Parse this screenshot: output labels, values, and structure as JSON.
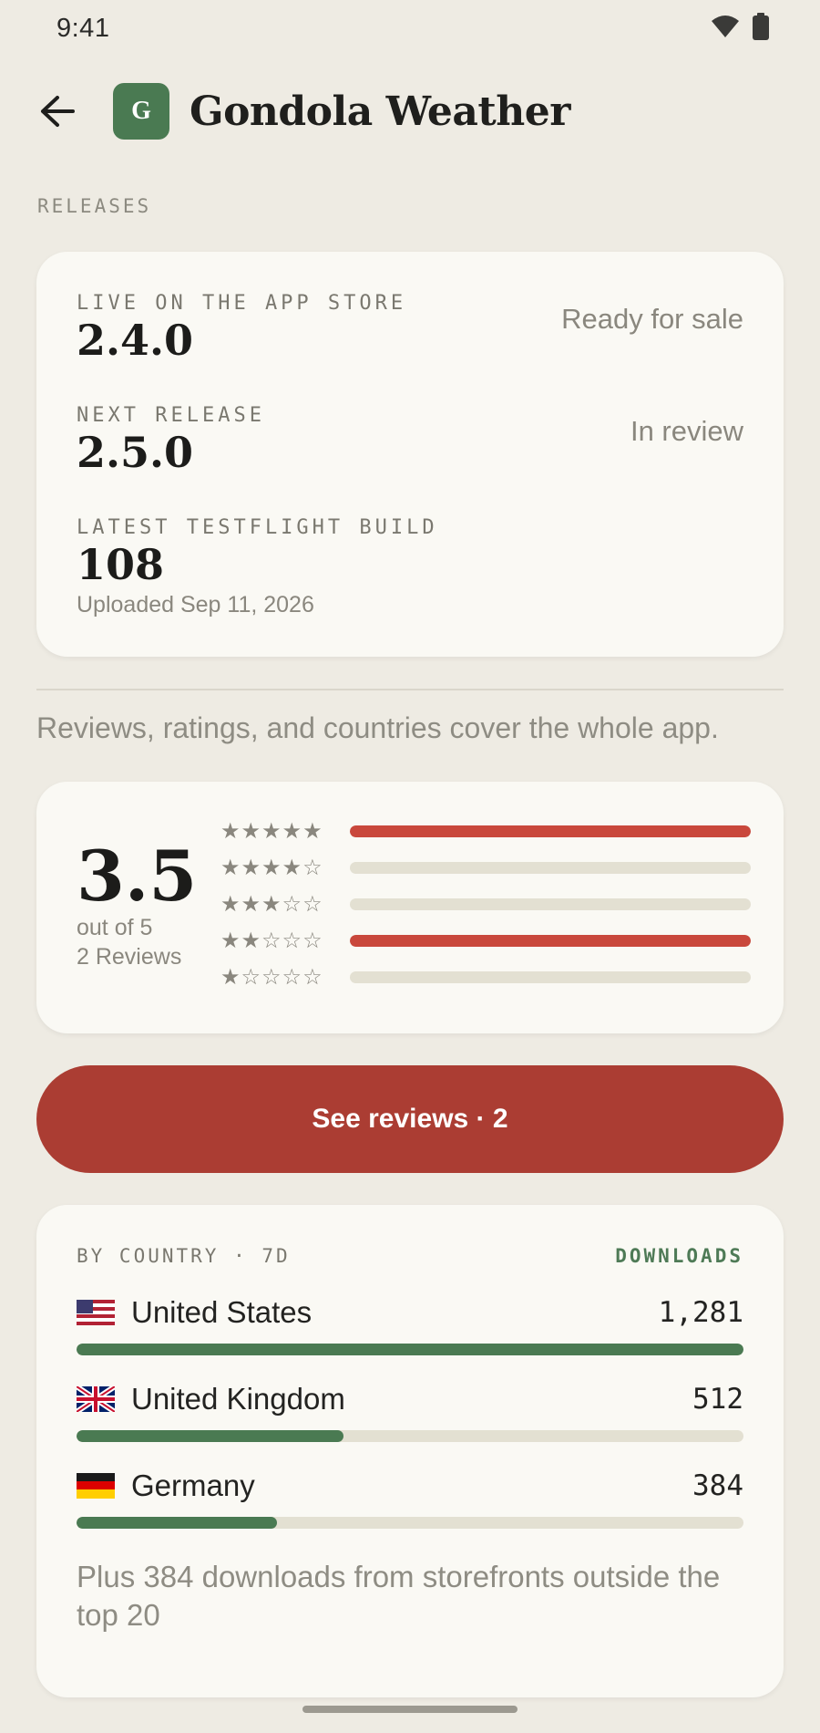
{
  "status_bar": {
    "time": "9:41",
    "icons": [
      "wifi-icon",
      "battery-icon"
    ]
  },
  "header": {
    "back_icon": "arrow-left-icon",
    "app_initial": "G",
    "app_name": "Gondola Weather"
  },
  "releases": {
    "section_label": "RELEASES",
    "items": [
      {
        "label": "LIVE ON THE APP STORE",
        "value": "2.4.0",
        "status": "Ready for sale"
      },
      {
        "label": "NEXT RELEASE",
        "value": "2.5.0",
        "status": "In review"
      },
      {
        "label": "LATEST TESTFLIGHT BUILD",
        "value": "108",
        "sub": "Uploaded Sep 11, 2026"
      }
    ]
  },
  "note": "Reviews, ratings, and countries cover the whole app.",
  "ratings": {
    "average": "3.5",
    "out_of": "out of 5",
    "count_label": "2 Reviews",
    "distribution": [
      {
        "stars": "★★★★★",
        "share": 1.0
      },
      {
        "stars": "★★★★☆",
        "share": 0.0
      },
      {
        "stars": "★★★☆☆",
        "share": 0.0
      },
      {
        "stars": "★★☆☆☆",
        "share": 1.0
      },
      {
        "stars": "★☆☆☆☆",
        "share": 0.0
      }
    ],
    "bar_color": "#C9483C"
  },
  "reviews_button": {
    "label": "See reviews · 2",
    "color": "#AB3D33"
  },
  "countries": {
    "title": "BY COUNTRY · 7D",
    "metric": "DOWNLOADS",
    "items": [
      {
        "name": "United States",
        "flag": "us-flag-icon",
        "count": "1,281",
        "share": 1.0
      },
      {
        "name": "United Kingdom",
        "flag": "uk-flag-icon",
        "count": "512",
        "share": 0.4
      },
      {
        "name": "Germany",
        "flag": "de-flag-icon",
        "count": "384",
        "share": 0.3
      }
    ],
    "footnote": "Plus 384 downloads from storefronts outside the top 20",
    "bar_color": "#4A7A52"
  }
}
